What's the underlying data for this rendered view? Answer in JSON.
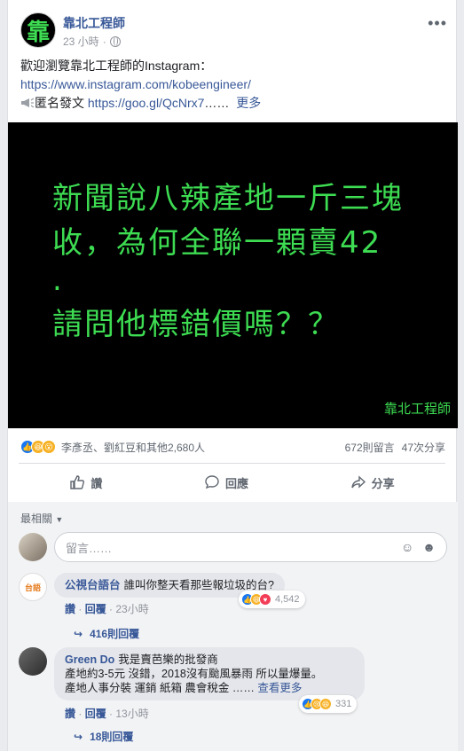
{
  "post": {
    "page_name": "靠北工程師",
    "avatar_char": "靠",
    "time": "23 小時",
    "text_line1": "歡迎瀏覽靠北工程師的Instagram：",
    "link1": "https://www.instagram.com/kobeengineer/",
    "anon_label": "匿名發文",
    "link2": "https://goo.gl/QcNrx7",
    "ellipsis": "……",
    "more": "更多",
    "image": {
      "line1": "新聞說八辣產地一斤三塊",
      "line2": "收，為何全聯一顆賣42",
      "line3": ".",
      "line4": "請問他標錯價嗎？？",
      "signature": "靠北工程師"
    },
    "reactions_names": "李彥丞、劉紅豆和其他2,680人",
    "comments_count": "672則留言",
    "shares_count": "47次分享",
    "actions": {
      "like": "讚",
      "comment": "回應",
      "share": "分享"
    }
  },
  "comments": {
    "sort_label": "最相關",
    "placeholder": "留言……",
    "items": [
      {
        "author": "公視台語台",
        "text": "誰叫你整天看那些報垃圾的台?",
        "like": "讚",
        "reply": "回覆",
        "time": "23小時",
        "reaction_count": "4,542",
        "replies": "416則回覆",
        "avatar_text": "台語"
      },
      {
        "author": "Green Do",
        "text_line1": "我是賣芭樂的批發商",
        "text_line2": "產地約3-5元 沒錯，2018沒有颱風暴雨 所以量爆量。",
        "text_line3": "產地人事分裝 運銷 紙箱 農會稅金 ……",
        "see_more": "查看更多",
        "like": "讚",
        "reply": "回覆",
        "time": "13小時",
        "reaction_count": "331",
        "replies": "18則回覆"
      }
    ]
  }
}
